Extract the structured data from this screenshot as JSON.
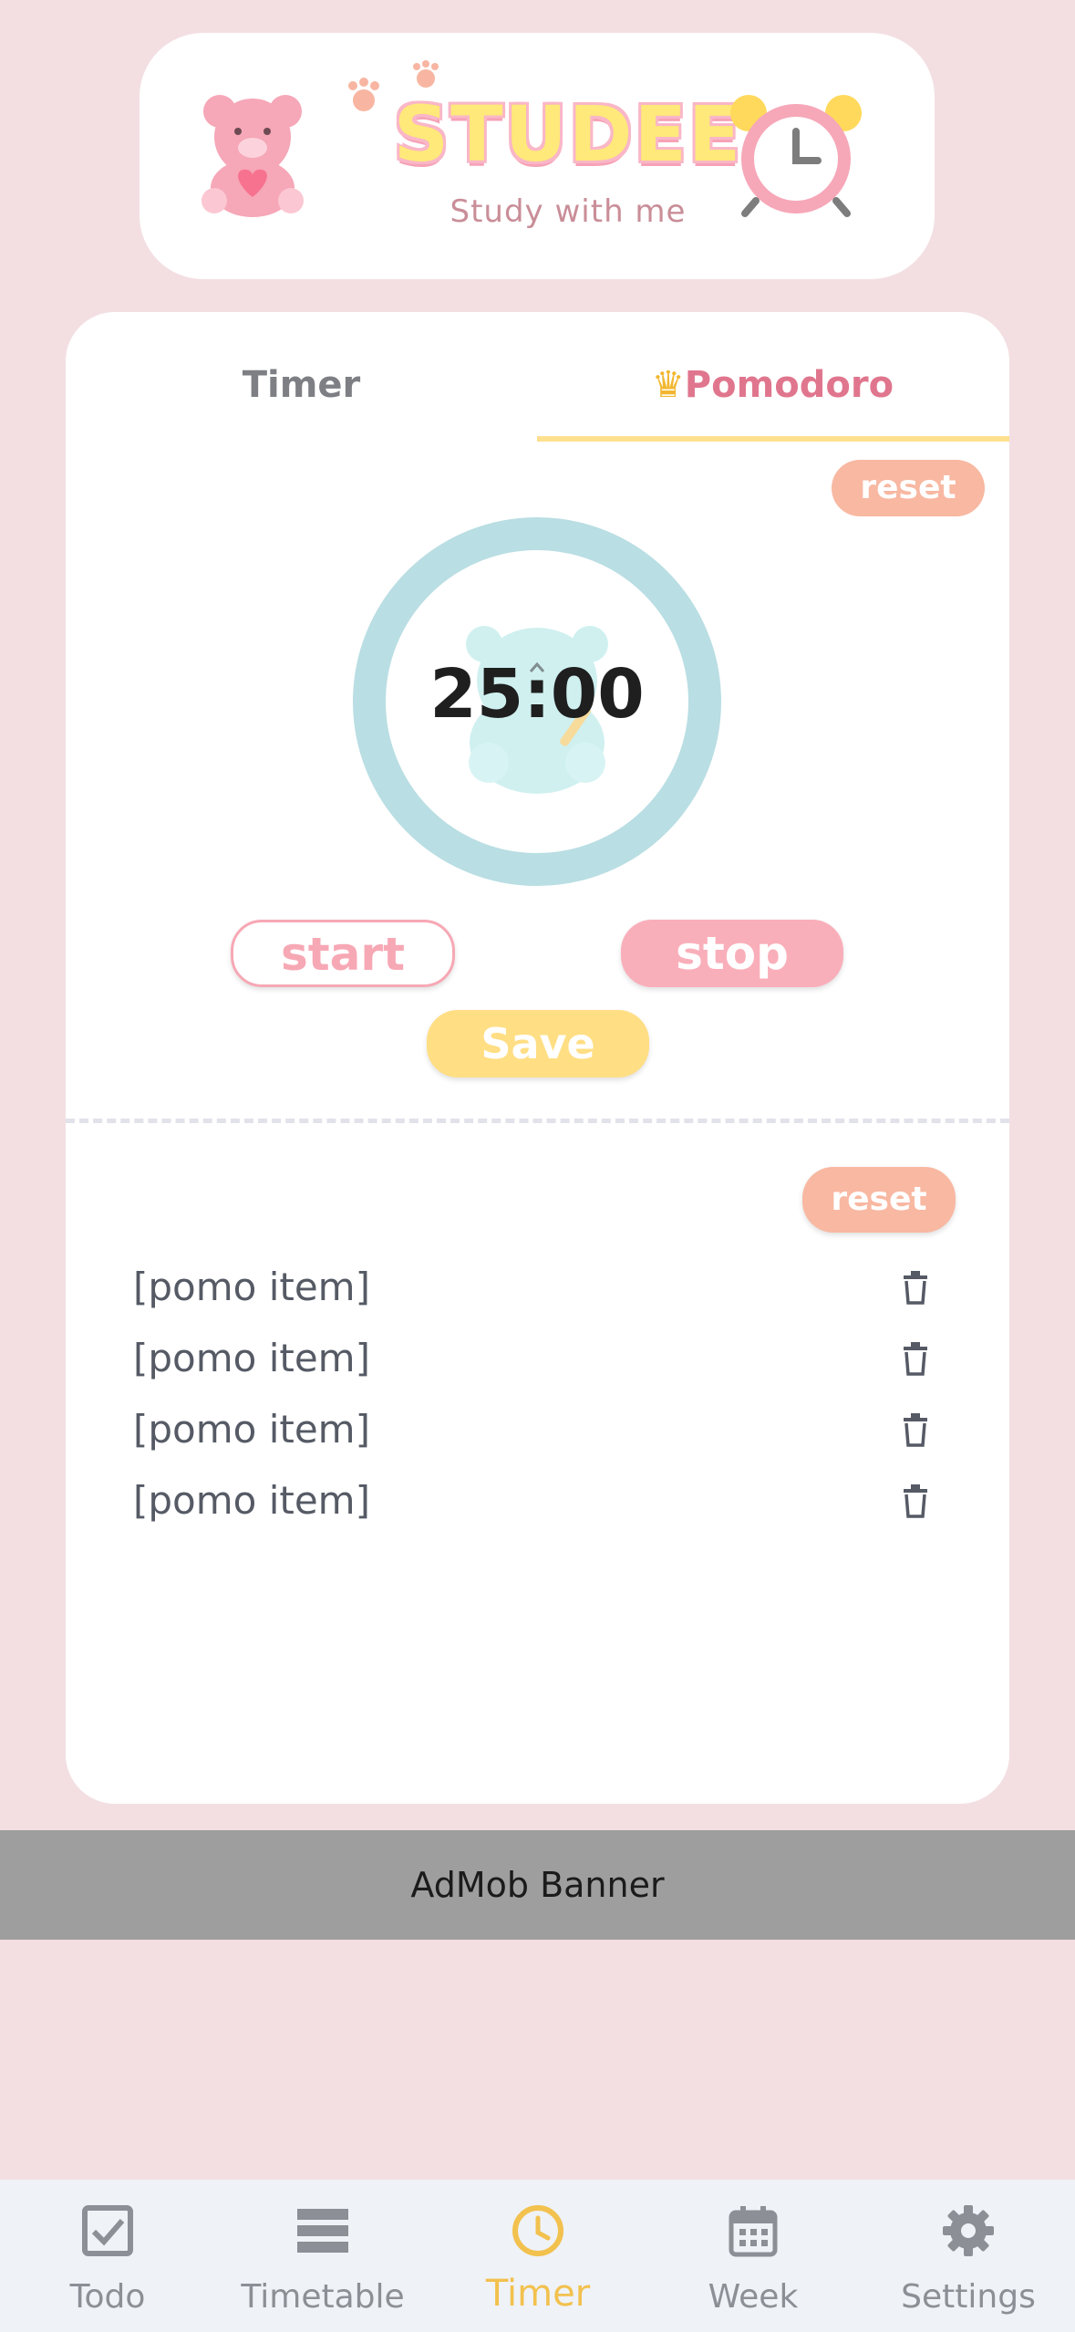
{
  "logo": {
    "title": "STUDEE",
    "subtitle": "Study with me"
  },
  "tabs": [
    {
      "label": "Timer",
      "active": false
    },
    {
      "label": "Pomodoro",
      "active": true,
      "icon": "crown-icon"
    }
  ],
  "timer": {
    "reset_label": "reset",
    "time": "25:00",
    "start_label": "start",
    "stop_label": "stop",
    "save_label": "Save"
  },
  "pomo_list": {
    "reset_label": "reset",
    "items": [
      "[pomo item]",
      "[pomo item]",
      "[pomo item]",
      "[pomo item]"
    ]
  },
  "banner": {
    "label": "AdMob Banner"
  },
  "bottom_nav": [
    {
      "label": "Todo",
      "icon": "checkbox-icon"
    },
    {
      "label": "Timetable",
      "icon": "table-icon"
    },
    {
      "label": "Timer",
      "icon": "clock-icon",
      "active": true
    },
    {
      "label": "Week",
      "icon": "calendar-icon"
    },
    {
      "label": "Settings",
      "icon": "gear-icon"
    }
  ],
  "colors": {
    "background": "#F3DFE2",
    "accent_pink": "#F7A8B5",
    "accent_yellow": "#FFDE84",
    "reset": "#F8B8A2",
    "ring": "#B9DEE3",
    "nav_active": "#F2C14E"
  }
}
